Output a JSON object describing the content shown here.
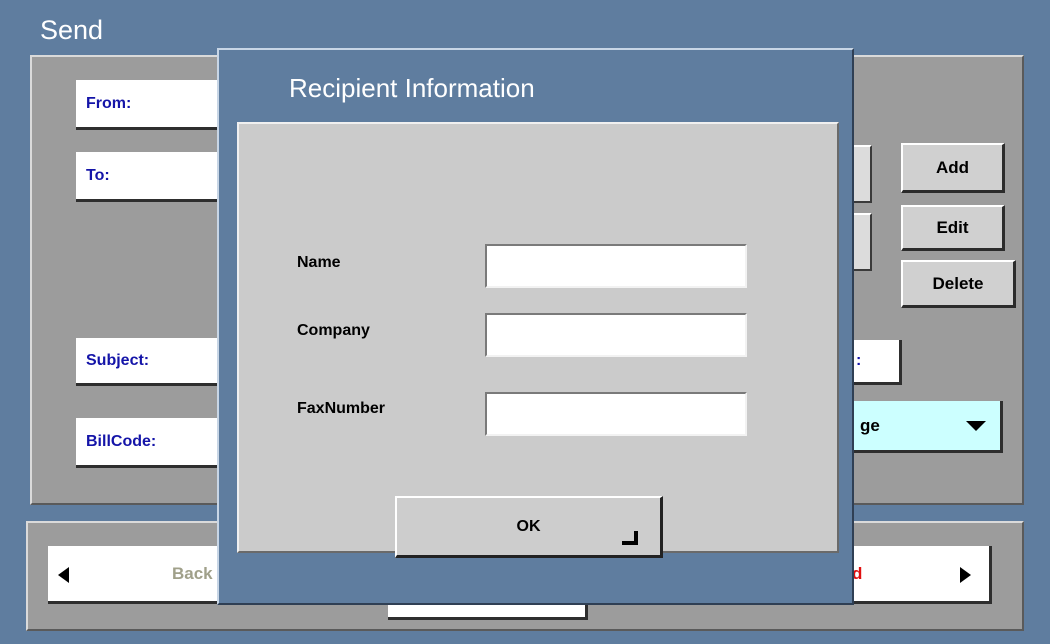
{
  "window": {
    "title": "Send"
  },
  "fields": {
    "from_label": "From:",
    "to_label": "To:",
    "subject_label": "Subject:",
    "billcode_label": "BillCode:"
  },
  "recipient_buttons": {
    "add": "Add",
    "edit": "Edit",
    "delete": "Delete"
  },
  "partial": {
    "right_label_fragment": ":",
    "dropdown_fragment": "ge"
  },
  "nav": {
    "back_fragment": "Back",
    "send_fragment": "d"
  },
  "dialog": {
    "title": "Recipient Information",
    "name_label": "Name",
    "company_label": "Company",
    "fax_label": "FaxNumber",
    "name_value": "",
    "company_value": "",
    "fax_value": "",
    "ok_label": "OK"
  },
  "colors": {
    "background": "#5f7d9f",
    "panel": "#9c9c9c",
    "label_blue": "#1414a8",
    "nav_send_red": "#e01010",
    "dropdown_cyan": "#ccffff"
  }
}
